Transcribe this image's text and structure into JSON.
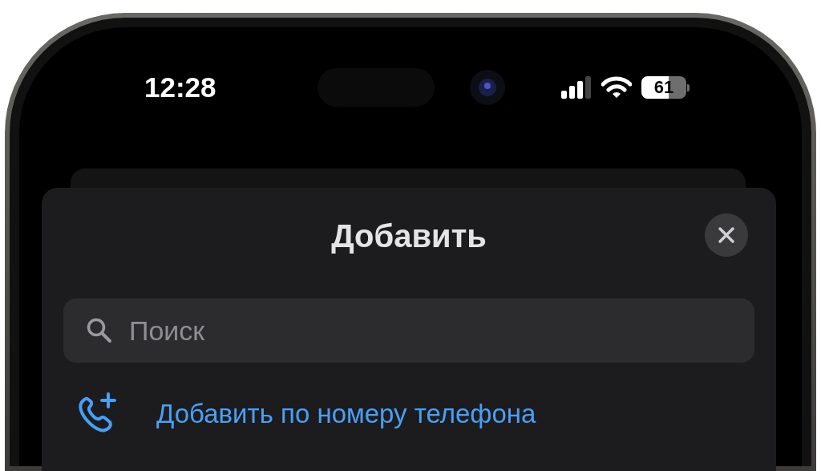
{
  "status_bar": {
    "time": "12:28",
    "battery": "61"
  },
  "sheet": {
    "title": "Добавить",
    "search": {
      "placeholder": "Поиск"
    },
    "actions": [
      {
        "label": "Добавить по номеру телефона",
        "kind": "add-phone"
      }
    ]
  }
}
